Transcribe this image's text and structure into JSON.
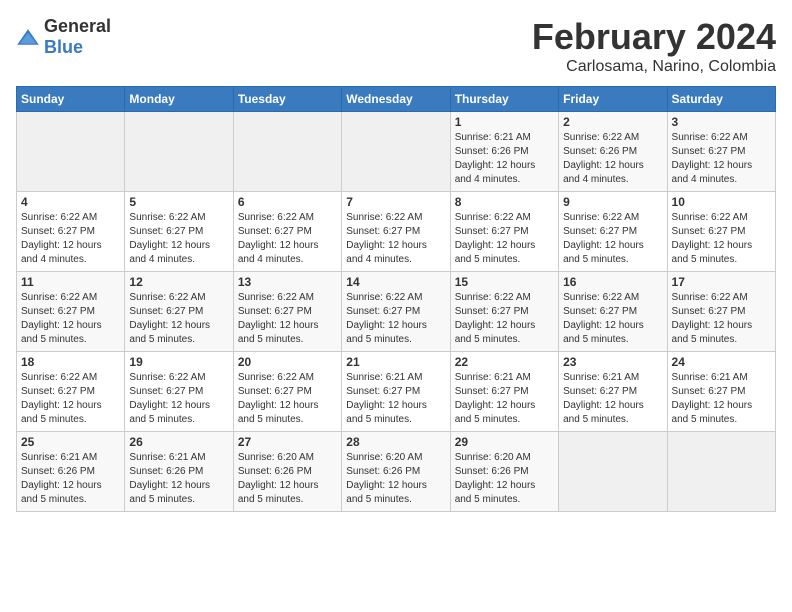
{
  "logo": {
    "text_general": "General",
    "text_blue": "Blue"
  },
  "header": {
    "month_title": "February 2024",
    "location": "Carlosama, Narino, Colombia"
  },
  "weekdays": [
    "Sunday",
    "Monday",
    "Tuesday",
    "Wednesday",
    "Thursday",
    "Friday",
    "Saturday"
  ],
  "weeks": [
    [
      {
        "day": "",
        "info": ""
      },
      {
        "day": "",
        "info": ""
      },
      {
        "day": "",
        "info": ""
      },
      {
        "day": "",
        "info": ""
      },
      {
        "day": "1",
        "info": "Sunrise: 6:21 AM\nSunset: 6:26 PM\nDaylight: 12 hours\nand 4 minutes."
      },
      {
        "day": "2",
        "info": "Sunrise: 6:22 AM\nSunset: 6:26 PM\nDaylight: 12 hours\nand 4 minutes."
      },
      {
        "day": "3",
        "info": "Sunrise: 6:22 AM\nSunset: 6:27 PM\nDaylight: 12 hours\nand 4 minutes."
      }
    ],
    [
      {
        "day": "4",
        "info": "Sunrise: 6:22 AM\nSunset: 6:27 PM\nDaylight: 12 hours\nand 4 minutes."
      },
      {
        "day": "5",
        "info": "Sunrise: 6:22 AM\nSunset: 6:27 PM\nDaylight: 12 hours\nand 4 minutes."
      },
      {
        "day": "6",
        "info": "Sunrise: 6:22 AM\nSunset: 6:27 PM\nDaylight: 12 hours\nand 4 minutes."
      },
      {
        "day": "7",
        "info": "Sunrise: 6:22 AM\nSunset: 6:27 PM\nDaylight: 12 hours\nand 4 minutes."
      },
      {
        "day": "8",
        "info": "Sunrise: 6:22 AM\nSunset: 6:27 PM\nDaylight: 12 hours\nand 5 minutes."
      },
      {
        "day": "9",
        "info": "Sunrise: 6:22 AM\nSunset: 6:27 PM\nDaylight: 12 hours\nand 5 minutes."
      },
      {
        "day": "10",
        "info": "Sunrise: 6:22 AM\nSunset: 6:27 PM\nDaylight: 12 hours\nand 5 minutes."
      }
    ],
    [
      {
        "day": "11",
        "info": "Sunrise: 6:22 AM\nSunset: 6:27 PM\nDaylight: 12 hours\nand 5 minutes."
      },
      {
        "day": "12",
        "info": "Sunrise: 6:22 AM\nSunset: 6:27 PM\nDaylight: 12 hours\nand 5 minutes."
      },
      {
        "day": "13",
        "info": "Sunrise: 6:22 AM\nSunset: 6:27 PM\nDaylight: 12 hours\nand 5 minutes."
      },
      {
        "day": "14",
        "info": "Sunrise: 6:22 AM\nSunset: 6:27 PM\nDaylight: 12 hours\nand 5 minutes."
      },
      {
        "day": "15",
        "info": "Sunrise: 6:22 AM\nSunset: 6:27 PM\nDaylight: 12 hours\nand 5 minutes."
      },
      {
        "day": "16",
        "info": "Sunrise: 6:22 AM\nSunset: 6:27 PM\nDaylight: 12 hours\nand 5 minutes."
      },
      {
        "day": "17",
        "info": "Sunrise: 6:22 AM\nSunset: 6:27 PM\nDaylight: 12 hours\nand 5 minutes."
      }
    ],
    [
      {
        "day": "18",
        "info": "Sunrise: 6:22 AM\nSunset: 6:27 PM\nDaylight: 12 hours\nand 5 minutes."
      },
      {
        "day": "19",
        "info": "Sunrise: 6:22 AM\nSunset: 6:27 PM\nDaylight: 12 hours\nand 5 minutes."
      },
      {
        "day": "20",
        "info": "Sunrise: 6:22 AM\nSunset: 6:27 PM\nDaylight: 12 hours\nand 5 minutes."
      },
      {
        "day": "21",
        "info": "Sunrise: 6:21 AM\nSunset: 6:27 PM\nDaylight: 12 hours\nand 5 minutes."
      },
      {
        "day": "22",
        "info": "Sunrise: 6:21 AM\nSunset: 6:27 PM\nDaylight: 12 hours\nand 5 minutes."
      },
      {
        "day": "23",
        "info": "Sunrise: 6:21 AM\nSunset: 6:27 PM\nDaylight: 12 hours\nand 5 minutes."
      },
      {
        "day": "24",
        "info": "Sunrise: 6:21 AM\nSunset: 6:27 PM\nDaylight: 12 hours\nand 5 minutes."
      }
    ],
    [
      {
        "day": "25",
        "info": "Sunrise: 6:21 AM\nSunset: 6:26 PM\nDaylight: 12 hours\nand 5 minutes."
      },
      {
        "day": "26",
        "info": "Sunrise: 6:21 AM\nSunset: 6:26 PM\nDaylight: 12 hours\nand 5 minutes."
      },
      {
        "day": "27",
        "info": "Sunrise: 6:20 AM\nSunset: 6:26 PM\nDaylight: 12 hours\nand 5 minutes."
      },
      {
        "day": "28",
        "info": "Sunrise: 6:20 AM\nSunset: 6:26 PM\nDaylight: 12 hours\nand 5 minutes."
      },
      {
        "day": "29",
        "info": "Sunrise: 6:20 AM\nSunset: 6:26 PM\nDaylight: 12 hours\nand 5 minutes."
      },
      {
        "day": "",
        "info": ""
      },
      {
        "day": "",
        "info": ""
      }
    ]
  ]
}
